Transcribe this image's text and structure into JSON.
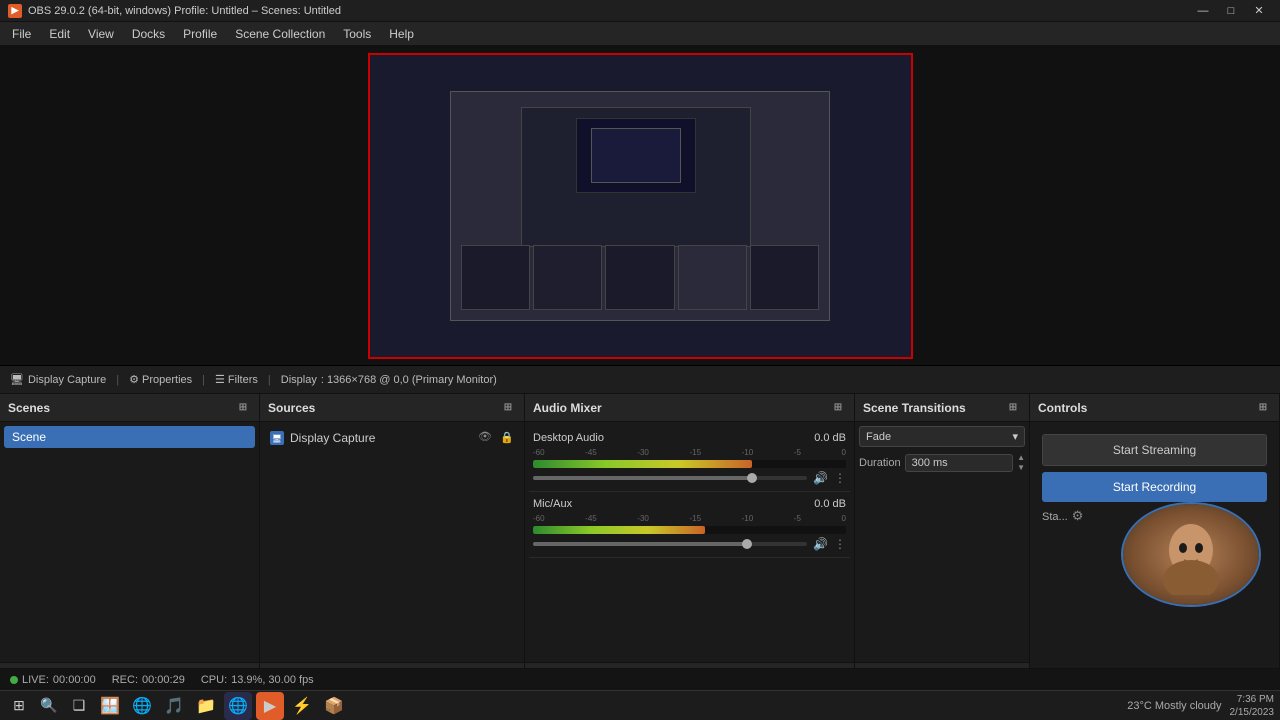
{
  "titlebar": {
    "icon": "▶",
    "title": "OBS 29.0.2 (64-bit, windows)  Profile: Untitled – Scenes: Untitled",
    "minimize": "—",
    "maximize": "□",
    "close": "✕"
  },
  "menubar": {
    "items": [
      "File",
      "Edit",
      "View",
      "Docks",
      "Profile",
      "Scene Collection",
      "Tools",
      "Help"
    ]
  },
  "sourcebar": {
    "icon": "□",
    "display_capture": "Display Capture",
    "properties": "⚙ Properties",
    "filters": "☰ Filters",
    "display_label": "Display",
    "resolution": ": 1366×768 @ 0,0 (Primary Monitor)"
  },
  "panels": {
    "scenes": {
      "title": "Scenes",
      "scene_item": "Scene",
      "footer_buttons": [
        "+",
        "✕",
        "□",
        "▲",
        "▼"
      ]
    },
    "sources": {
      "title": "Sources",
      "items": [
        {
          "icon": "□",
          "name": "Display Capture",
          "visible": true,
          "locked": true
        }
      ],
      "footer_buttons": [
        "+",
        "✕",
        "⚙",
        "▲",
        "▼"
      ]
    },
    "audio_mixer": {
      "title": "Audio Mixer",
      "tracks": [
        {
          "name": "Desktop Audio",
          "db": "0.0 dB",
          "meter_pct": 70,
          "volume_pct": 80,
          "scale": [
            "-60",
            "-45",
            "-30",
            "-15",
            "-10",
            "-5",
            "0"
          ]
        },
        {
          "name": "Mic/Aux",
          "db": "0.0 dB",
          "meter_pct": 55,
          "volume_pct": 78,
          "scale": [
            "-60",
            "-45",
            "-30",
            "-15",
            "-10",
            "-5",
            "0"
          ]
        }
      ],
      "footer_icons": [
        "🔗",
        "⋮"
      ]
    },
    "scene_transitions": {
      "title": "Scene Transitions",
      "type": "Fade",
      "duration_label": "Duration",
      "duration_value": "300 ms",
      "footer_buttons": [
        "+",
        "✕",
        "⋮"
      ]
    },
    "controls": {
      "title": "Controls",
      "start_streaming": "Start Streaming",
      "start_recording": "Start Recording",
      "status_label": "Sta...",
      "gear_icon": "⚙"
    }
  },
  "statusbar": {
    "live_label": "LIVE:",
    "live_time": "00:00:00",
    "rec_label": "REC:",
    "rec_time": "00:00:29",
    "cpu_label": "CPU:",
    "cpu_value": "13.9%, 30.00 fps"
  },
  "taskbar": {
    "start_icon": "⊞",
    "search_icon": "🔍",
    "taskview_icon": "❑",
    "apps": [
      "🪟",
      "🌐",
      "🎵",
      "📁",
      "🌐",
      "🔴",
      "⚡",
      "📦"
    ],
    "weather": "23°C  Mostly cloudy",
    "time": "7:36 PM",
    "date": "2/15/2023"
  }
}
